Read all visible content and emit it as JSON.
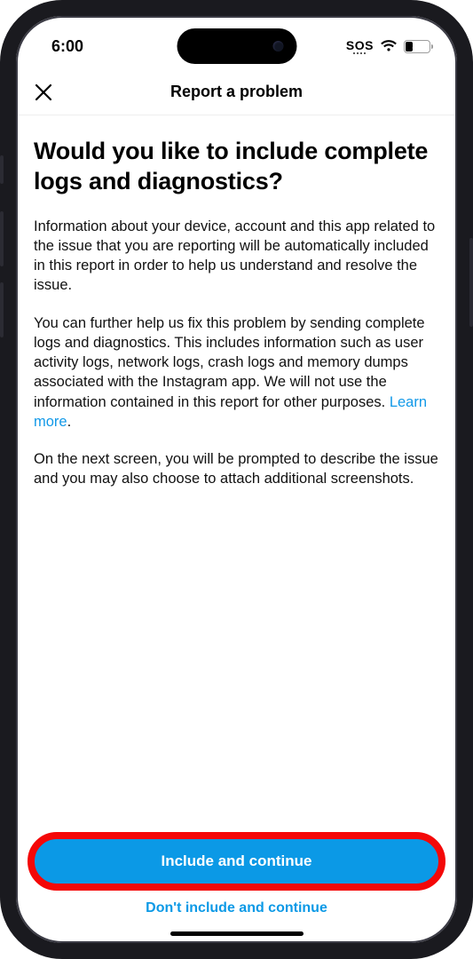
{
  "status": {
    "time": "6:00",
    "sos": "SOS",
    "battery_percent": "27"
  },
  "nav": {
    "title": "Report a problem"
  },
  "page": {
    "headline": "Would you like to include complete logs and diagnostics?",
    "para1": "Information about your device, account and this app related to the issue that you are reporting will be automatically included in this report in order to help us understand and resolve the issue.",
    "para2a": "You can further help us fix this problem by sending complete logs and diagnostics. This includes information such as user activity logs, network logs, crash logs and memory dumps associated with the Instagram app. We will not use the information contained in this report for other purposes. ",
    "learn_more": "Learn more",
    "period": ".",
    "para3": "On the next screen, you will be prompted to describe the issue and you may also choose to attach additional screenshots."
  },
  "actions": {
    "primary": "Include and continue",
    "secondary": "Don't include and continue"
  }
}
